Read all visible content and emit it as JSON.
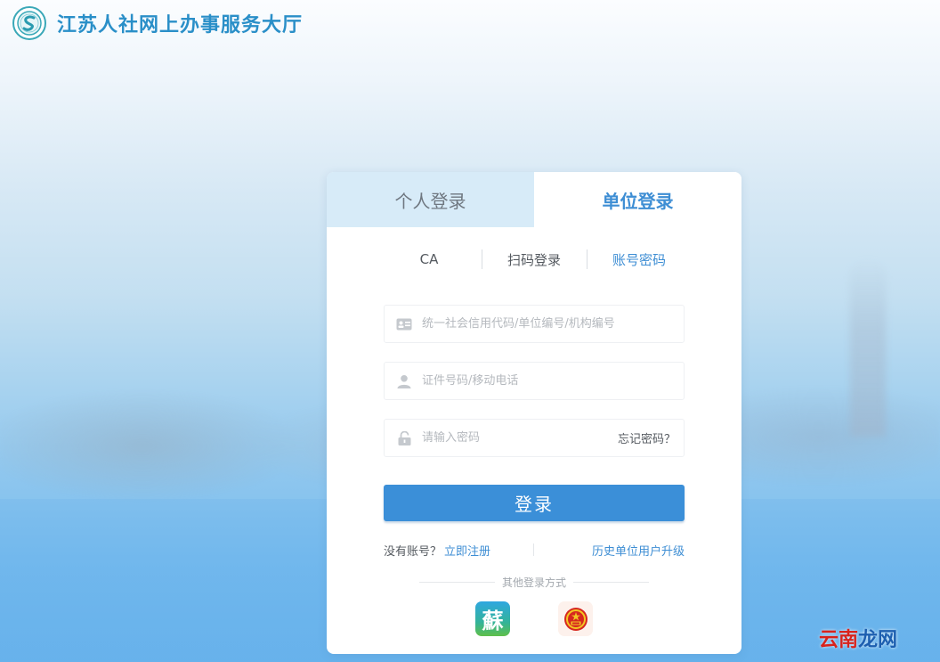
{
  "header": {
    "site_title": "江苏人社网上办事服务大厅",
    "logo_icon": "jiangsu-hrss-logo-icon"
  },
  "login": {
    "main_tabs": [
      {
        "label": "个人登录",
        "active": false
      },
      {
        "label": "单位登录",
        "active": true
      }
    ],
    "sub_tabs": [
      {
        "label": "CA",
        "active": false
      },
      {
        "label": "扫码登录",
        "active": false
      },
      {
        "label": "账号密码",
        "active": true
      }
    ],
    "fields": {
      "org_code": {
        "placeholder": "统一社会信用代码/单位编号/机构编号",
        "value": "",
        "icon": "id-card-icon"
      },
      "cert_no": {
        "placeholder": "证件号码/移动电话",
        "value": "",
        "icon": "user-icon"
      },
      "password": {
        "placeholder": "请输入密码",
        "value": "",
        "icon": "lock-icon"
      }
    },
    "forgot_label": "忘记密码？",
    "submit_label": "登录",
    "no_account_label": "没有账号？",
    "register_label": "立即注册",
    "upgrade_label": "历史单位用户升级",
    "other_methods_label": "其他登录方式",
    "other_methods": [
      {
        "label": "蘇",
        "icon": "su-service-app-icon"
      },
      {
        "icon": "national-emblem-icon"
      }
    ]
  },
  "watermark": {
    "part1": "云南",
    "part2": "龙网"
  },
  "colors": {
    "accent": "#3e8ed4",
    "button": "#3b8fd8",
    "title": "#2a8fc8",
    "tab_inactive_bg": "#d7ebf8"
  }
}
